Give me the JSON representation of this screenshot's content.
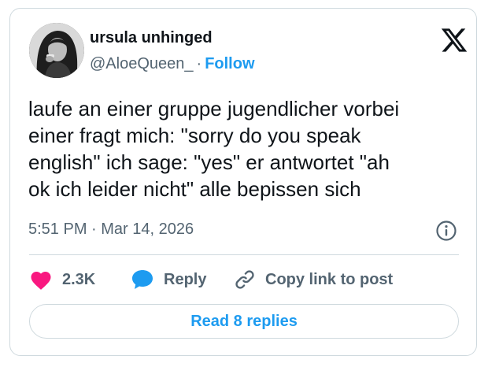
{
  "author": {
    "display_name": "ursula unhinged",
    "handle": "@AloeQueen_",
    "separator": "·",
    "follow_label": "Follow"
  },
  "tweet": {
    "text": "laufe an einer gruppe jugendlicher vorbei\neiner fragt mich: \"sorry do you speak\nenglish\" ich sage: \"yes\" er antwortet \"ah\nok ich leider nicht\" alle bepissen sich",
    "timestamp": "5:51 PM · Mar 14, 2026"
  },
  "actions": {
    "like_count": "2.3K",
    "reply_label": "Reply",
    "copy_link_label": "Copy link to post"
  },
  "read_replies_label": "Read 8 replies",
  "icons": {
    "logo": "x-logo-icon",
    "info": "info-icon",
    "like": "heart-icon",
    "reply": "speech-bubble-icon",
    "copy": "link-icon"
  },
  "colors": {
    "accent": "#1d9bf0",
    "heart": "#f91880",
    "secondary_text": "#536471",
    "border": "#cfd9de"
  }
}
